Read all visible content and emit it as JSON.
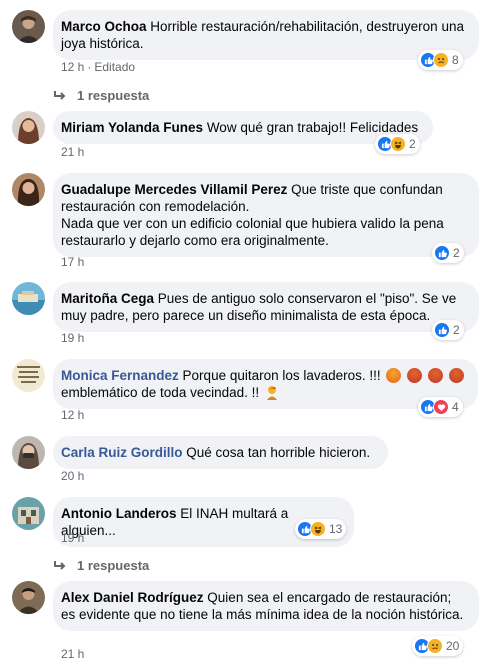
{
  "comments": [
    {
      "author": "Marco Ochoa",
      "text": "Horrible restauración/rehabilitación, destruyeron una joya histórica.",
      "time": "12 h",
      "edited": "Editado",
      "reaction_count": "8",
      "reaction_icons": [
        "like-icon",
        "sad-icon"
      ],
      "replies": "1 respuesta"
    },
    {
      "author": "Miriam Yolanda Funes",
      "text": "Wow qué gran trabajo!! Felicidades",
      "time": "21 h",
      "reaction_count": "2",
      "reaction_icons": [
        "like-icon",
        "haha-icon"
      ]
    },
    {
      "author": "Guadalupe Mercedes Villamil Perez",
      "text": "Que triste que confundan restauración con remodelación.",
      "text2": "Nada que ver con un edificio colonial que hubiera valido la pena restaurarlo y dejarlo como era originalmente.",
      "time": "17 h",
      "reaction_count": "2",
      "reaction_icons": [
        "like-icon"
      ]
    },
    {
      "author": "Maritoña Cega",
      "text": "Pues de antiguo solo conservaron el \"piso\". Se ve muy padre, pero parece un diseño minimalista de esta época.",
      "time": "19 h",
      "reaction_count": "2",
      "reaction_icons": [
        "like-icon"
      ]
    },
    {
      "author": "Monica Fernandez",
      "text": "Porque quitaron los lavaderos. !!!",
      "text2": "emblemático de toda vecindad. !!",
      "time": "12 h",
      "reaction_count": "4",
      "reaction_icons": [
        "like-icon",
        "love-icon"
      ]
    },
    {
      "author": "Carla Ruiz Gordillo",
      "text": "Qué cosa tan horrible hicieron.",
      "time": "20 h"
    },
    {
      "author": "Antonio Landeros",
      "text": "El INAH multará a alguien...",
      "time": "19 h",
      "reaction_count": "13",
      "reaction_icons": [
        "like-icon",
        "haha-icon"
      ],
      "replies": "1 respuesta"
    },
    {
      "author": "Alex Daniel Rodríguez",
      "text": "Quien sea el encargado de restauración; es evidente que no tiene la más mínima idea de la noción histórica.",
      "time": "21 h",
      "reaction_count": "20",
      "reaction_icons": [
        "like-icon",
        "sad-icon"
      ]
    }
  ],
  "colors": {
    "bubble_bg": "#f0f2f5",
    "meta_text": "#65676b",
    "link_author": "#385898",
    "like_blue": "#1877f2"
  }
}
